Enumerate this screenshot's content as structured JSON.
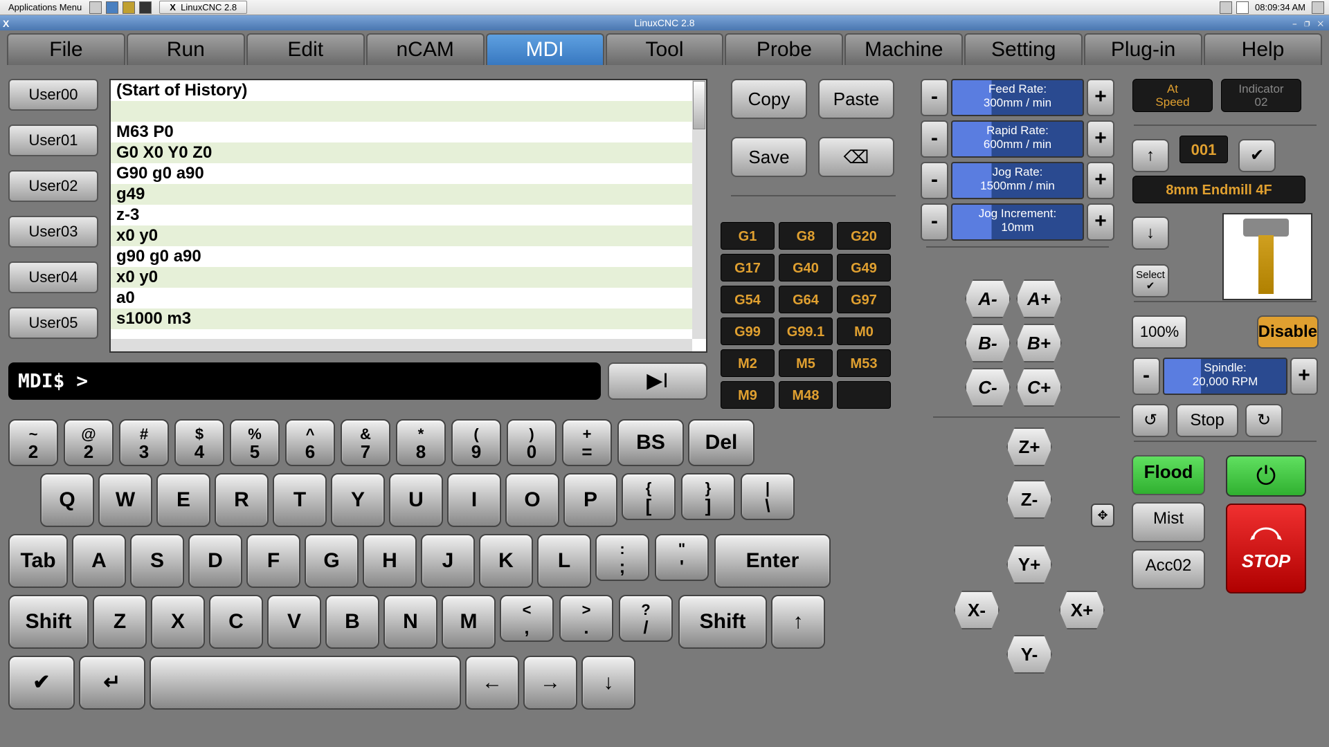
{
  "taskbar": {
    "menu": "Applications Menu",
    "app_button": "LinuxCNC 2.8",
    "clock": "08:09:34 AM"
  },
  "window": {
    "title": "LinuxCNC 2.8"
  },
  "tabs": [
    "File",
    "Run",
    "Edit",
    "nCAM",
    "MDI",
    "Tool",
    "Probe",
    "Machine",
    "Setting",
    "Plug-in",
    "Help"
  ],
  "active_tab": "MDI",
  "user_buttons": [
    "User00",
    "User01",
    "User02",
    "User03",
    "User04",
    "User05"
  ],
  "history": [
    "(Start of History)",
    "",
    "M63 P0",
    "G0 X0 Y0 Z0",
    "G90 g0 a90",
    "g49",
    "z-3",
    "x0 y0",
    "g90 g0 a90",
    "x0 y0",
    "a0",
    "s1000 m3"
  ],
  "mdi_prompt": "MDI$ >",
  "run_button_glyph": "▶I",
  "edit_buttons": {
    "copy": "Copy",
    "paste": "Paste",
    "save": "Save",
    "backspace_glyph": "⌫"
  },
  "gcodes": [
    "G1",
    "G8",
    "G20",
    "G17",
    "G40",
    "G49",
    "G54",
    "G64",
    "G97",
    "G99",
    "G99.1",
    "M0",
    "M2",
    "M5",
    "M53",
    "M9",
    "M48",
    ""
  ],
  "rates": [
    {
      "label": "Feed Rate:",
      "value": "300mm / min"
    },
    {
      "label": "Rapid Rate:",
      "value": "600mm / min"
    },
    {
      "label": "Jog Rate:",
      "value": "1500mm / min"
    },
    {
      "label": "Jog Increment:",
      "value": "10mm"
    }
  ],
  "jog_abc": [
    [
      "A-",
      "A+"
    ],
    [
      "B-",
      "B+"
    ],
    [
      "C-",
      "C+"
    ]
  ],
  "jog_xyz": {
    "zplus": "Z+",
    "zmin": "Z-",
    "yplus": "Y+",
    "xmin": "X-",
    "xplus": "X+",
    "ymin": "Y-",
    "pan": "✥"
  },
  "status": {
    "at_speed": "At\nSpeed",
    "indicator": "Indicator\n02",
    "tool_index": "001",
    "tool_name": "8mm Endmill 4F"
  },
  "rctl": {
    "up": "↑",
    "down": "↓",
    "ok": "✔",
    "select": "Select\n✔",
    "percent": "100%",
    "disable": "Disable",
    "stop": "Stop",
    "ccw": "↺",
    "cw": "↻",
    "flood": "Flood",
    "mist": "Mist",
    "acc02": "Acc02",
    "power": "⏻",
    "estop": "STOP"
  },
  "spindle": {
    "label": "Spindle:",
    "value": "20,000 RPM"
  },
  "keyboard": {
    "row1": [
      [
        "~",
        "2"
      ],
      [
        "@",
        "2"
      ],
      [
        "#",
        "3"
      ],
      [
        "$",
        "4"
      ],
      [
        "%",
        "5"
      ],
      [
        "^",
        "6"
      ],
      [
        "&",
        "7"
      ],
      [
        "*",
        "8"
      ],
      [
        "(",
        "9"
      ],
      [
        ")",
        "0"
      ],
      [
        "+",
        "="
      ]
    ],
    "bs": "BS",
    "del": "Del",
    "row2": [
      "Q",
      "W",
      "E",
      "R",
      "T",
      "Y",
      "U",
      "I",
      "O",
      "P",
      [
        "{",
        "["
      ],
      [
        "}",
        "]"
      ],
      [
        "|",
        "\\"
      ]
    ],
    "tab": "Tab",
    "row3": [
      "A",
      "S",
      "D",
      "F",
      "G",
      "H",
      "J",
      "K",
      "L",
      [
        ":",
        ";"
      ],
      [
        "\"",
        "'"
      ]
    ],
    "enter": "Enter",
    "shift": "Shift",
    "row4": [
      "Z",
      "X",
      "C",
      "V",
      "B",
      "N",
      "M",
      [
        "<",
        ","
      ],
      [
        ">",
        "."
      ],
      [
        "?",
        "/"
      ]
    ],
    "up": "↑",
    "row5": {
      "check": "✔",
      "ret": "↵",
      "left": "←",
      "right": "→",
      "down": "↓",
      "space": " "
    }
  }
}
